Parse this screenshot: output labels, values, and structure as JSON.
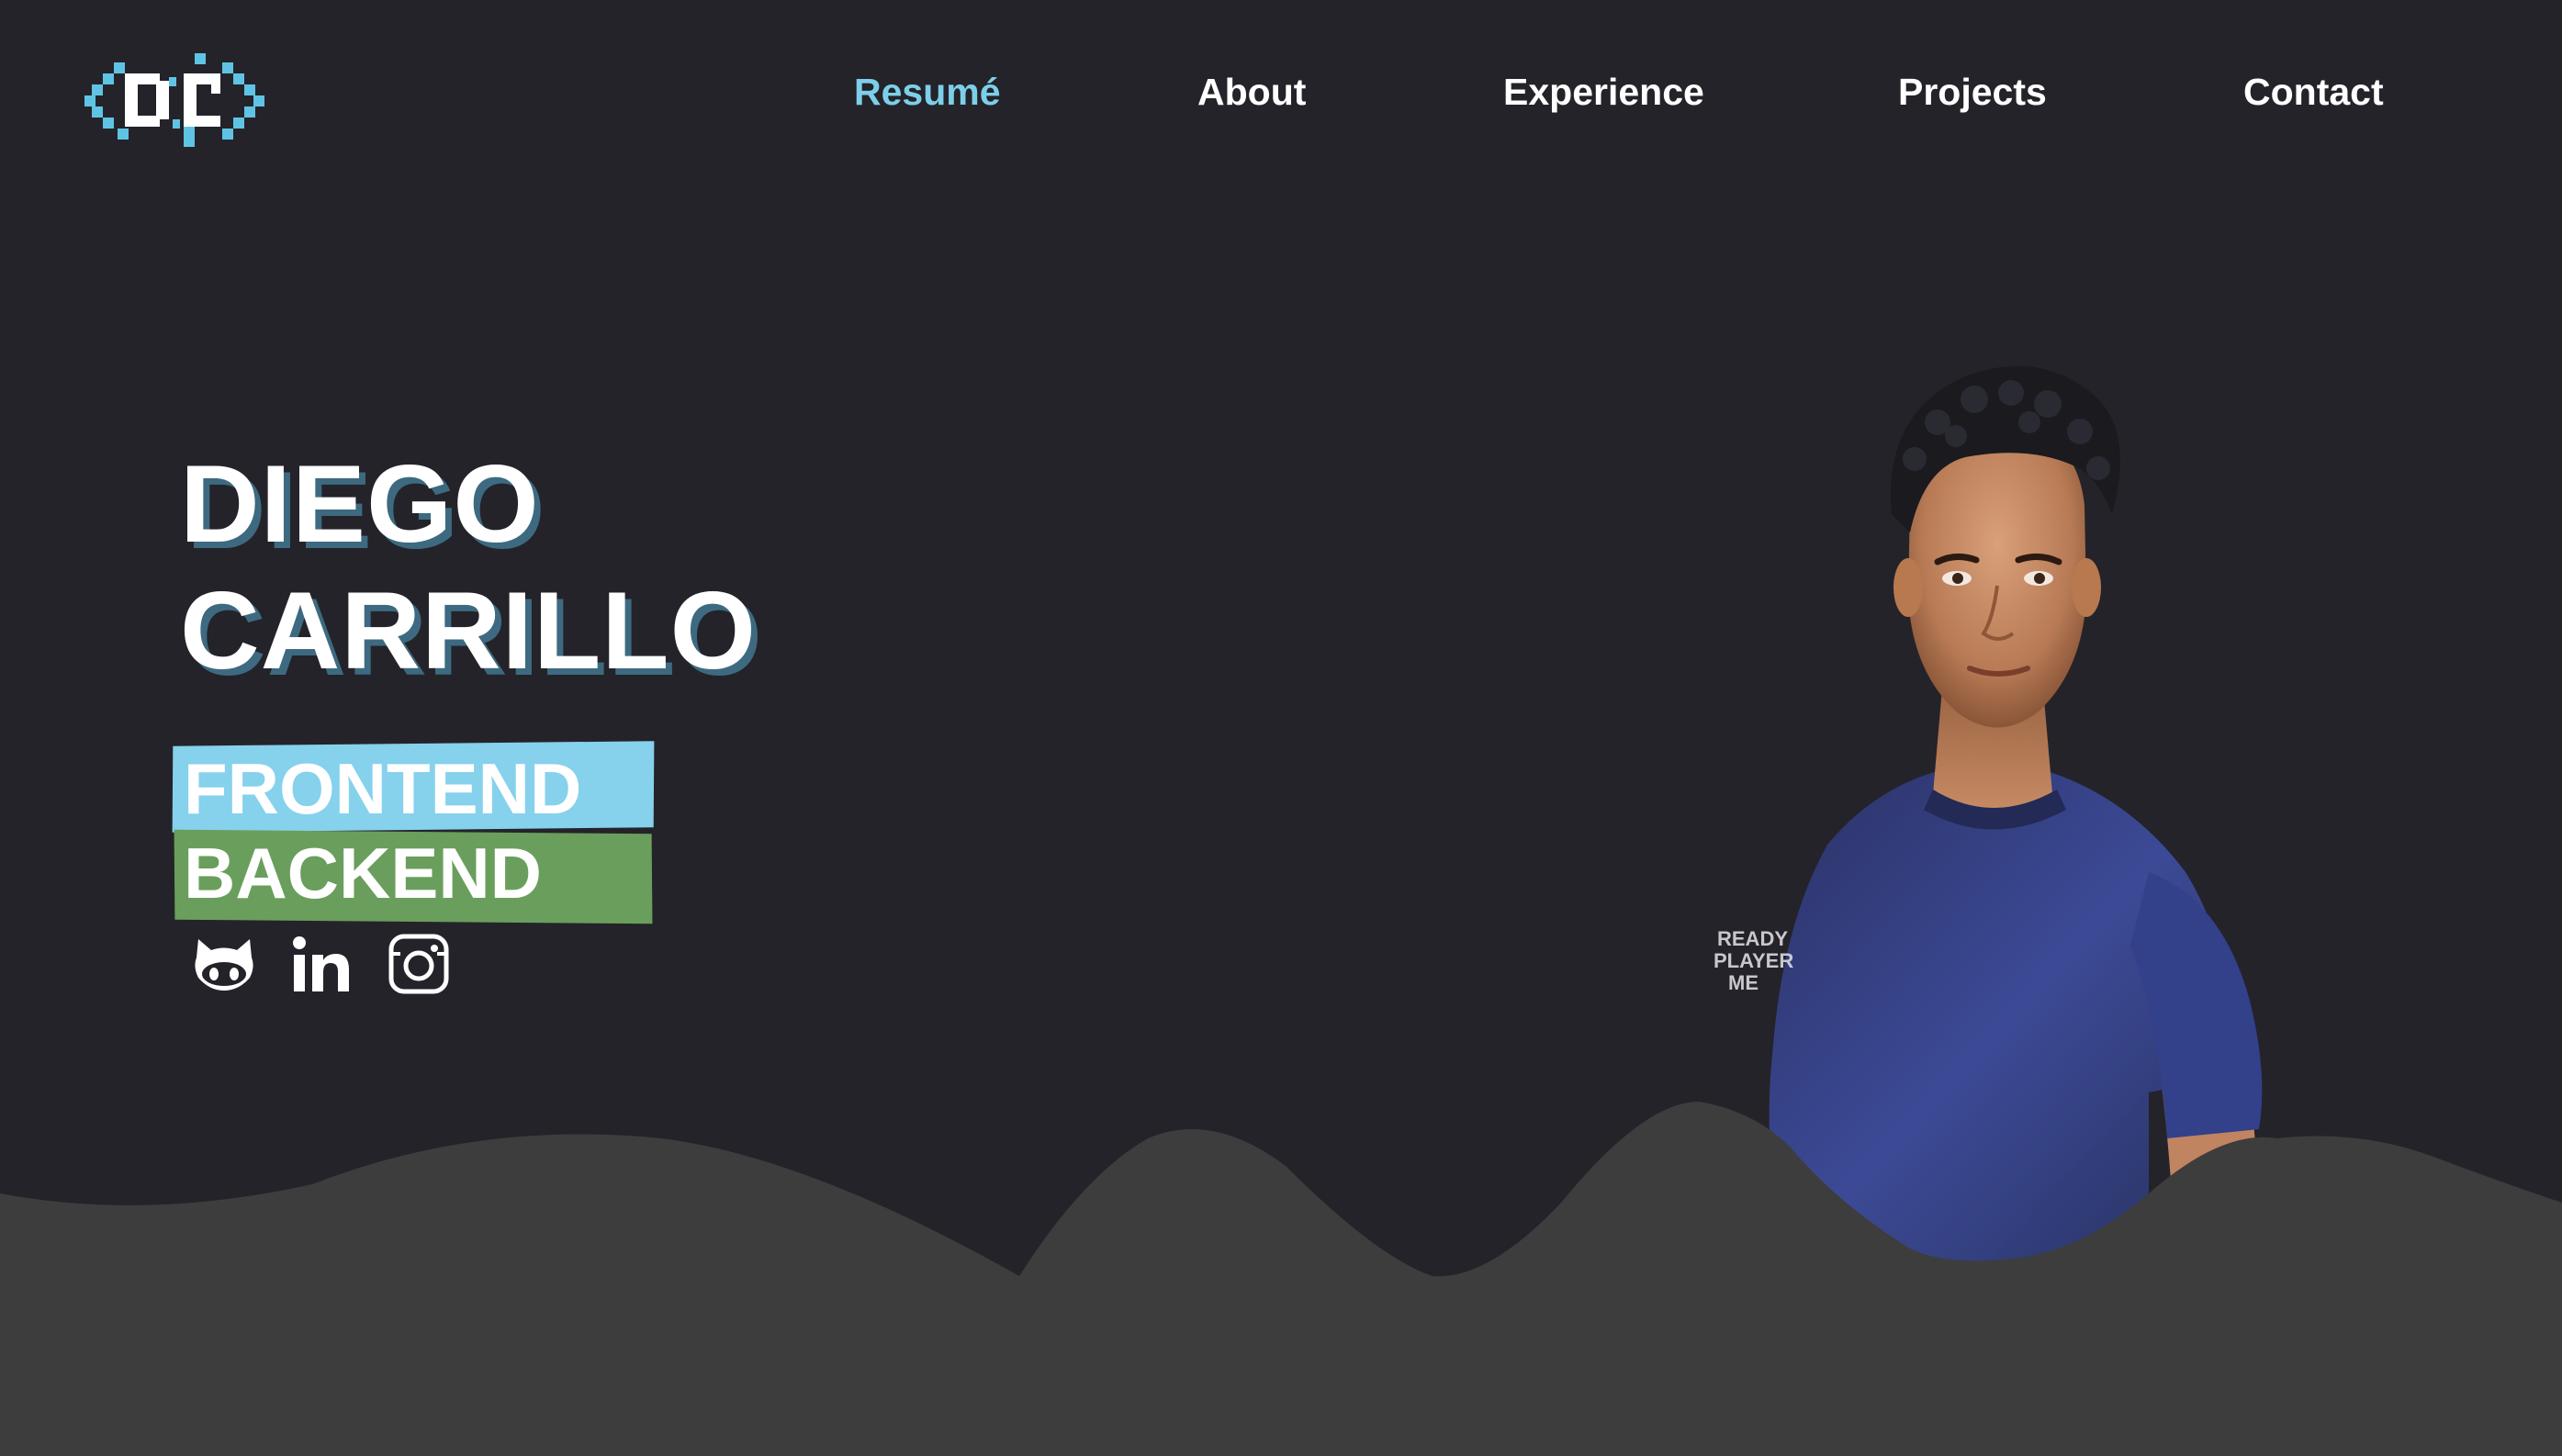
{
  "logo": {
    "icon": "dc-pixel-logo-icon",
    "accent": "#5fc4e3"
  },
  "nav": {
    "items": [
      {
        "label": "Resumé",
        "active": true
      },
      {
        "label": "About",
        "active": false
      },
      {
        "label": "Experience",
        "active": false
      },
      {
        "label": "Projects",
        "active": false
      },
      {
        "label": "Contact",
        "active": false
      }
    ]
  },
  "hero": {
    "first_name": "DIEGO",
    "last_name": "CARRILLO",
    "tags": [
      {
        "label": "FRONTEND",
        "color": "#86d1ec"
      },
      {
        "label": "BACKEND",
        "color": "#6a9e5c"
      }
    ],
    "socials": [
      {
        "icon": "github-icon"
      },
      {
        "icon": "linkedin-icon"
      },
      {
        "icon": "instagram-icon"
      }
    ]
  },
  "avatar": {
    "shirt_text": "READY PLAYER ME"
  },
  "colors": {
    "background": "#24232a",
    "wave": "#3d3d3d",
    "active_nav": "#7dcfe9",
    "text": "#ffffff"
  }
}
